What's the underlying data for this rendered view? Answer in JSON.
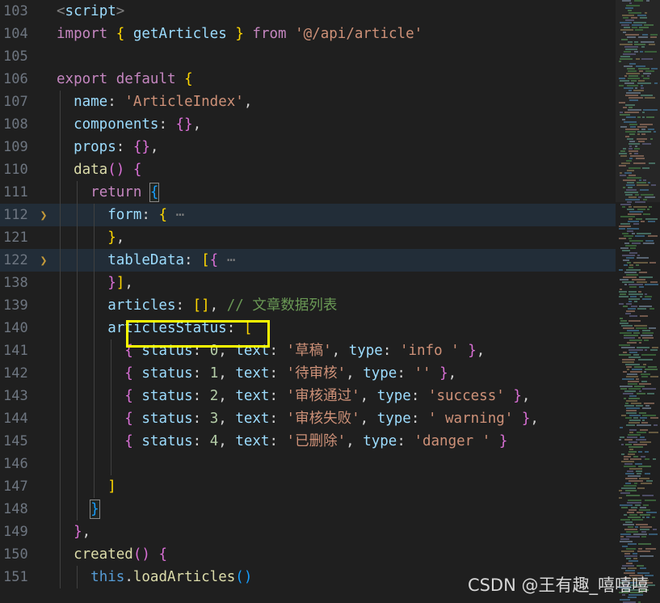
{
  "editor": {
    "background": "#1f1f1f",
    "folded_line_background": "#222d38",
    "annotation_color": "#ffff00",
    "first_line": 103,
    "lines": [
      {
        "num": "103",
        "fold": false,
        "highlight": false,
        "indent": 0,
        "tokens": [
          {
            "t": "<",
            "c": "tag"
          },
          {
            "t": "script",
            "c": "tagname"
          },
          {
            "t": ">",
            "c": "tag"
          }
        ]
      },
      {
        "num": "104",
        "fold": false,
        "highlight": false,
        "indent": 0,
        "tokens": [
          {
            "t": "import ",
            "c": "kw"
          },
          {
            "t": "{",
            "c": "p-yellow"
          },
          {
            "t": " ",
            "c": "plain"
          },
          {
            "t": "getArticles",
            "c": "prop"
          },
          {
            "t": " ",
            "c": "plain"
          },
          {
            "t": "}",
            "c": "p-yellow"
          },
          {
            "t": " ",
            "c": "plain"
          },
          {
            "t": "from",
            "c": "kw"
          },
          {
            "t": " ",
            "c": "plain"
          },
          {
            "t": "'@/api/article'",
            "c": "str"
          }
        ]
      },
      {
        "num": "105",
        "fold": false,
        "highlight": false,
        "indent": 0,
        "tokens": []
      },
      {
        "num": "106",
        "fold": false,
        "highlight": false,
        "indent": 0,
        "tokens": [
          {
            "t": "export",
            "c": "kw"
          },
          {
            "t": " ",
            "c": "plain"
          },
          {
            "t": "default",
            "c": "kw"
          },
          {
            "t": " ",
            "c": "plain"
          },
          {
            "t": "{",
            "c": "p-yellow"
          }
        ]
      },
      {
        "num": "107",
        "fold": false,
        "highlight": false,
        "indent": 1,
        "tokens": [
          {
            "t": "name",
            "c": "prop"
          },
          {
            "t": ": ",
            "c": "plain"
          },
          {
            "t": "'ArticleIndex'",
            "c": "str"
          },
          {
            "t": ",",
            "c": "plain"
          }
        ]
      },
      {
        "num": "108",
        "fold": false,
        "highlight": false,
        "indent": 1,
        "tokens": [
          {
            "t": "components",
            "c": "prop"
          },
          {
            "t": ": ",
            "c": "plain"
          },
          {
            "t": "{}",
            "c": "p-pink"
          },
          {
            "t": ",",
            "c": "plain"
          }
        ]
      },
      {
        "num": "109",
        "fold": false,
        "highlight": false,
        "indent": 1,
        "tokens": [
          {
            "t": "props",
            "c": "prop"
          },
          {
            "t": ": ",
            "c": "plain"
          },
          {
            "t": "{}",
            "c": "p-pink"
          },
          {
            "t": ",",
            "c": "plain"
          }
        ]
      },
      {
        "num": "110",
        "fold": false,
        "highlight": false,
        "indent": 1,
        "tokens": [
          {
            "t": "data",
            "c": "fn"
          },
          {
            "t": "()",
            "c": "p-pink"
          },
          {
            "t": " ",
            "c": "plain"
          },
          {
            "t": "{",
            "c": "p-pink"
          }
        ]
      },
      {
        "num": "111",
        "fold": false,
        "highlight": false,
        "indent": 2,
        "tokens": [
          {
            "t": "return",
            "c": "kw"
          },
          {
            "t": " ",
            "c": "plain"
          },
          {
            "t": "{",
            "c": "p-blue",
            "box": true
          }
        ]
      },
      {
        "num": "112",
        "fold": true,
        "highlight": true,
        "indent": 3,
        "tokens": [
          {
            "t": "form",
            "c": "prop"
          },
          {
            "t": ": ",
            "c": "plain"
          },
          {
            "t": "{",
            "c": "p-yellow"
          },
          {
            "t": " ",
            "c": "plain"
          },
          {
            "t": "⋯",
            "c": "dots"
          }
        ]
      },
      {
        "num": "121",
        "fold": false,
        "highlight": false,
        "indent": 3,
        "tokens": [
          {
            "t": "}",
            "c": "p-yellow"
          },
          {
            "t": ",",
            "c": "plain"
          }
        ]
      },
      {
        "num": "122",
        "fold": true,
        "highlight": true,
        "indent": 3,
        "tokens": [
          {
            "t": "tableData",
            "c": "prop"
          },
          {
            "t": ": ",
            "c": "plain"
          },
          {
            "t": "[",
            "c": "p-yellow"
          },
          {
            "t": "{",
            "c": "p-pink"
          },
          {
            "t": " ",
            "c": "plain"
          },
          {
            "t": "⋯",
            "c": "dots"
          }
        ]
      },
      {
        "num": "138",
        "fold": false,
        "highlight": false,
        "indent": 3,
        "tokens": [
          {
            "t": "}",
            "c": "p-pink"
          },
          {
            "t": "]",
            "c": "p-yellow"
          },
          {
            "t": ",",
            "c": "plain"
          }
        ]
      },
      {
        "num": "139",
        "fold": false,
        "highlight": false,
        "indent": 3,
        "tokens": [
          {
            "t": "articles",
            "c": "prop"
          },
          {
            "t": ": ",
            "c": "plain"
          },
          {
            "t": "[]",
            "c": "p-yellow"
          },
          {
            "t": ", ",
            "c": "plain"
          },
          {
            "t": "// 文章数据列表",
            "c": "cmt"
          }
        ]
      },
      {
        "num": "140",
        "fold": false,
        "highlight": false,
        "indent": 3,
        "annotated": true,
        "tokens": [
          {
            "t": "articlesStatus",
            "c": "prop"
          },
          {
            "t": ": ",
            "c": "plain"
          },
          {
            "t": "[",
            "c": "p-yellow"
          }
        ]
      },
      {
        "num": "141",
        "fold": false,
        "highlight": false,
        "indent": 4,
        "tokens": [
          {
            "t": "{",
            "c": "p-pink"
          },
          {
            "t": " ",
            "c": "plain"
          },
          {
            "t": "status",
            "c": "prop"
          },
          {
            "t": ": ",
            "c": "plain"
          },
          {
            "t": "0",
            "c": "num"
          },
          {
            "t": ", ",
            "c": "plain"
          },
          {
            "t": "text",
            "c": "prop"
          },
          {
            "t": ": ",
            "c": "plain"
          },
          {
            "t": "'草稿'",
            "c": "str"
          },
          {
            "t": ", ",
            "c": "plain"
          },
          {
            "t": "type",
            "c": "prop"
          },
          {
            "t": ": ",
            "c": "plain"
          },
          {
            "t": "'info '",
            "c": "str"
          },
          {
            "t": " ",
            "c": "plain"
          },
          {
            "t": "}",
            "c": "p-pink"
          },
          {
            "t": ",",
            "c": "plain"
          }
        ]
      },
      {
        "num": "142",
        "fold": false,
        "highlight": false,
        "indent": 4,
        "tokens": [
          {
            "t": "{",
            "c": "p-pink"
          },
          {
            "t": " ",
            "c": "plain"
          },
          {
            "t": "status",
            "c": "prop"
          },
          {
            "t": ": ",
            "c": "plain"
          },
          {
            "t": "1",
            "c": "num"
          },
          {
            "t": ", ",
            "c": "plain"
          },
          {
            "t": "text",
            "c": "prop"
          },
          {
            "t": ": ",
            "c": "plain"
          },
          {
            "t": "'待审核'",
            "c": "str"
          },
          {
            "t": ", ",
            "c": "plain"
          },
          {
            "t": "type",
            "c": "prop"
          },
          {
            "t": ": ",
            "c": "plain"
          },
          {
            "t": "''",
            "c": "str"
          },
          {
            "t": " ",
            "c": "plain"
          },
          {
            "t": "}",
            "c": "p-pink"
          },
          {
            "t": ",",
            "c": "plain"
          }
        ]
      },
      {
        "num": "143",
        "fold": false,
        "highlight": false,
        "indent": 4,
        "tokens": [
          {
            "t": "{",
            "c": "p-pink"
          },
          {
            "t": " ",
            "c": "plain"
          },
          {
            "t": "status",
            "c": "prop"
          },
          {
            "t": ": ",
            "c": "plain"
          },
          {
            "t": "2",
            "c": "num"
          },
          {
            "t": ", ",
            "c": "plain"
          },
          {
            "t": "text",
            "c": "prop"
          },
          {
            "t": ": ",
            "c": "plain"
          },
          {
            "t": "'审核通过'",
            "c": "str"
          },
          {
            "t": ", ",
            "c": "plain"
          },
          {
            "t": "type",
            "c": "prop"
          },
          {
            "t": ": ",
            "c": "plain"
          },
          {
            "t": "'success'",
            "c": "str"
          },
          {
            "t": " ",
            "c": "plain"
          },
          {
            "t": "}",
            "c": "p-pink"
          },
          {
            "t": ",",
            "c": "plain"
          }
        ]
      },
      {
        "num": "144",
        "fold": false,
        "highlight": false,
        "indent": 4,
        "tokens": [
          {
            "t": "{",
            "c": "p-pink"
          },
          {
            "t": " ",
            "c": "plain"
          },
          {
            "t": "status",
            "c": "prop"
          },
          {
            "t": ": ",
            "c": "plain"
          },
          {
            "t": "3",
            "c": "num"
          },
          {
            "t": ", ",
            "c": "plain"
          },
          {
            "t": "text",
            "c": "prop"
          },
          {
            "t": ": ",
            "c": "plain"
          },
          {
            "t": "'审核失败'",
            "c": "str"
          },
          {
            "t": ", ",
            "c": "plain"
          },
          {
            "t": "type",
            "c": "prop"
          },
          {
            "t": ": ",
            "c": "plain"
          },
          {
            "t": "' warning'",
            "c": "str"
          },
          {
            "t": " ",
            "c": "plain"
          },
          {
            "t": "}",
            "c": "p-pink"
          },
          {
            "t": ",",
            "c": "plain"
          }
        ]
      },
      {
        "num": "145",
        "fold": false,
        "highlight": false,
        "indent": 4,
        "tokens": [
          {
            "t": "{",
            "c": "p-pink"
          },
          {
            "t": " ",
            "c": "plain"
          },
          {
            "t": "status",
            "c": "prop"
          },
          {
            "t": ": ",
            "c": "plain"
          },
          {
            "t": "4",
            "c": "num"
          },
          {
            "t": ", ",
            "c": "plain"
          },
          {
            "t": "text",
            "c": "prop"
          },
          {
            "t": ": ",
            "c": "plain"
          },
          {
            "t": "'已删除'",
            "c": "str"
          },
          {
            "t": ", ",
            "c": "plain"
          },
          {
            "t": "type",
            "c": "prop"
          },
          {
            "t": ": ",
            "c": "plain"
          },
          {
            "t": "'danger '",
            "c": "str"
          },
          {
            "t": " ",
            "c": "plain"
          },
          {
            "t": "}",
            "c": "p-pink"
          }
        ]
      },
      {
        "num": "146",
        "fold": false,
        "highlight": false,
        "indent": 4,
        "tokens": []
      },
      {
        "num": "147",
        "fold": false,
        "highlight": false,
        "indent": 3,
        "tokens": [
          {
            "t": "]",
            "c": "p-yellow"
          }
        ]
      },
      {
        "num": "148",
        "fold": false,
        "highlight": false,
        "indent": 2,
        "tokens": [
          {
            "t": "}",
            "c": "p-blue",
            "box": true
          }
        ]
      },
      {
        "num": "149",
        "fold": false,
        "highlight": false,
        "indent": 1,
        "tokens": [
          {
            "t": "}",
            "c": "p-pink"
          },
          {
            "t": ",",
            "c": "plain"
          }
        ]
      },
      {
        "num": "150",
        "fold": false,
        "highlight": false,
        "indent": 1,
        "tokens": [
          {
            "t": "created",
            "c": "fn"
          },
          {
            "t": "()",
            "c": "p-pink"
          },
          {
            "t": " ",
            "c": "plain"
          },
          {
            "t": "{",
            "c": "p-pink"
          }
        ]
      },
      {
        "num": "151",
        "fold": false,
        "highlight": false,
        "indent": 2,
        "tokens": [
          {
            "t": "this",
            "c": "kw2"
          },
          {
            "t": ".",
            "c": "plain"
          },
          {
            "t": "loadArticles",
            "c": "fn"
          },
          {
            "t": "()",
            "c": "p-blue"
          }
        ]
      }
    ]
  },
  "minimap": {
    "name": "code-minimap",
    "visible": true
  },
  "watermark": {
    "text": "CSDN @王有趣_嘻嘻嘻"
  }
}
